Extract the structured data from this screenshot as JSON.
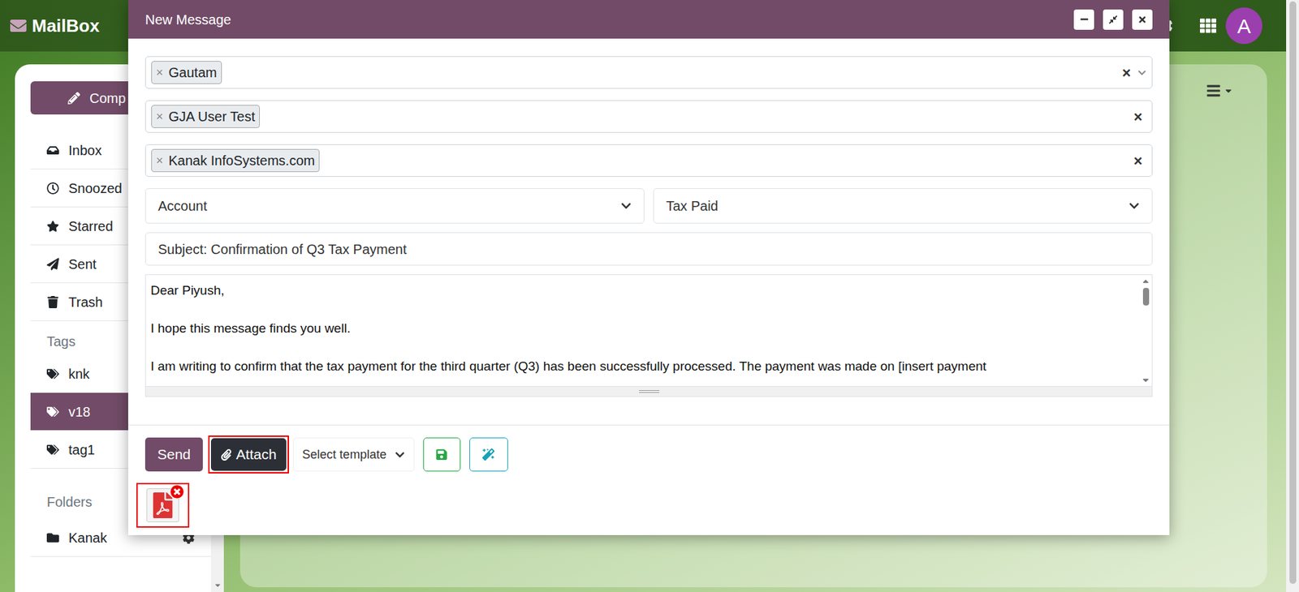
{
  "header": {
    "logo": "MailBox",
    "avatar": "A"
  },
  "sidebar": {
    "compose": "Comp",
    "items": [
      {
        "label": "Inbox",
        "icon": "inbox",
        "selected": false
      },
      {
        "label": "Snoozed",
        "icon": "clock",
        "selected": false
      },
      {
        "label": "Starred",
        "icon": "star",
        "selected": false
      },
      {
        "label": "Sent",
        "icon": "sent",
        "selected": false
      },
      {
        "label": "Trash",
        "icon": "trash",
        "selected": false
      }
    ],
    "tags_title": "Tags",
    "tags": [
      {
        "label": "knk",
        "selected": false
      },
      {
        "label": "v18",
        "selected": true
      },
      {
        "label": "tag1",
        "selected": false
      }
    ],
    "folders_title": "Folders",
    "folders": [
      {
        "label": "Kanak",
        "selected": false
      }
    ]
  },
  "compose": {
    "title": "New Message",
    "to": [
      {
        "label": "Gautam",
        "remove": "×"
      }
    ],
    "cc": [
      {
        "label": "GJA User Test",
        "remove": "×"
      }
    ],
    "bcc": [
      {
        "label": "Kanak InfoSystems.com",
        "remove": "×"
      }
    ],
    "clear": "×",
    "account": "Account",
    "tag": "Tax Paid",
    "subject": "Subject: Confirmation of Q3 Tax Payment",
    "body": [
      "Dear Piyush,",
      "I hope this message finds you well.",
      "I am writing to confirm that the tax payment for the third quarter (Q3) has been successfully processed. The payment was made on [insert payment"
    ],
    "send": "Send",
    "attach": {
      "label": "Attach",
      "highlighted": true
    },
    "template": "Select template",
    "attachments": [
      {
        "type": "pdf",
        "highlighted": true
      }
    ]
  }
}
